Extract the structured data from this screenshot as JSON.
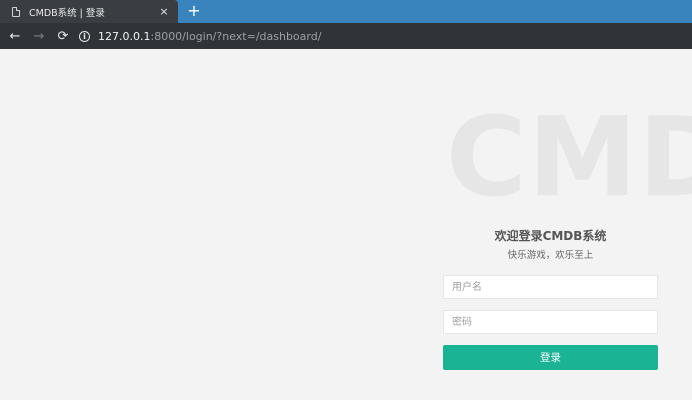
{
  "browser": {
    "tab_title": "CMDB系统 | 登录",
    "tab_close": "×",
    "new_tab": "+",
    "nav": {
      "back": "←",
      "forward": "→",
      "reload": "⟳"
    },
    "url_host": "127.0.0.1",
    "url_rest": ":8000/login/?next=/dashboard/"
  },
  "page": {
    "watermark": "CMDB",
    "title": "欢迎登录CMDB系统",
    "subtitle": "快乐游戏，欢乐至上",
    "username_placeholder": "用户名",
    "password_placeholder": "密码",
    "submit_label": "登录"
  },
  "colors": {
    "tabbar": "#3a84bd",
    "toolbar": "#303438",
    "page_bg": "#f3f3f3",
    "button": "#1ab394"
  }
}
